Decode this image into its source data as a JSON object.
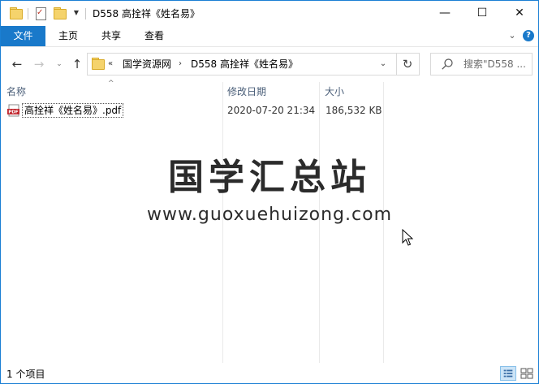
{
  "titlebar": {
    "title": "D558 高拴祥《姓名易》",
    "minimize_glyph": "—",
    "maximize_glyph": "☐",
    "close_glyph": "✕"
  },
  "ribbon": {
    "tabs": [
      {
        "label": "文件",
        "active": true
      },
      {
        "label": "主页"
      },
      {
        "label": "共享"
      },
      {
        "label": "查看"
      }
    ],
    "collapse_glyph": "⌄",
    "help_glyph": "?"
  },
  "navigation": {
    "back_glyph": "←",
    "forward_glyph": "→",
    "recent_glyph": "⌄",
    "up_glyph": "↑",
    "overflow_glyph": "«",
    "breadcrumb": [
      "国学资源网",
      "D558 高拴祥《姓名易》"
    ],
    "separator_glyph": "›",
    "dropdown_glyph": "⌄",
    "refresh_glyph": "↻"
  },
  "search": {
    "placeholder": "搜索\"D558 ..."
  },
  "columns": {
    "name": "名称",
    "modified": "修改日期",
    "size": "大小"
  },
  "files": [
    {
      "name": "高拴祥《姓名易》.pdf",
      "modified": "2020-07-20 21:34",
      "size": "186,532 KB",
      "icon": "pdf-file-icon",
      "icon_label": "PDF"
    }
  ],
  "watermark": {
    "chinese": "国学汇总站",
    "url": "www.guoxuehuizong.com"
  },
  "status": {
    "item_count": "1 个项目"
  },
  "colors": {
    "accent": "#1979ca",
    "folder": "#f5d36c",
    "header_text": "#4c607a"
  }
}
